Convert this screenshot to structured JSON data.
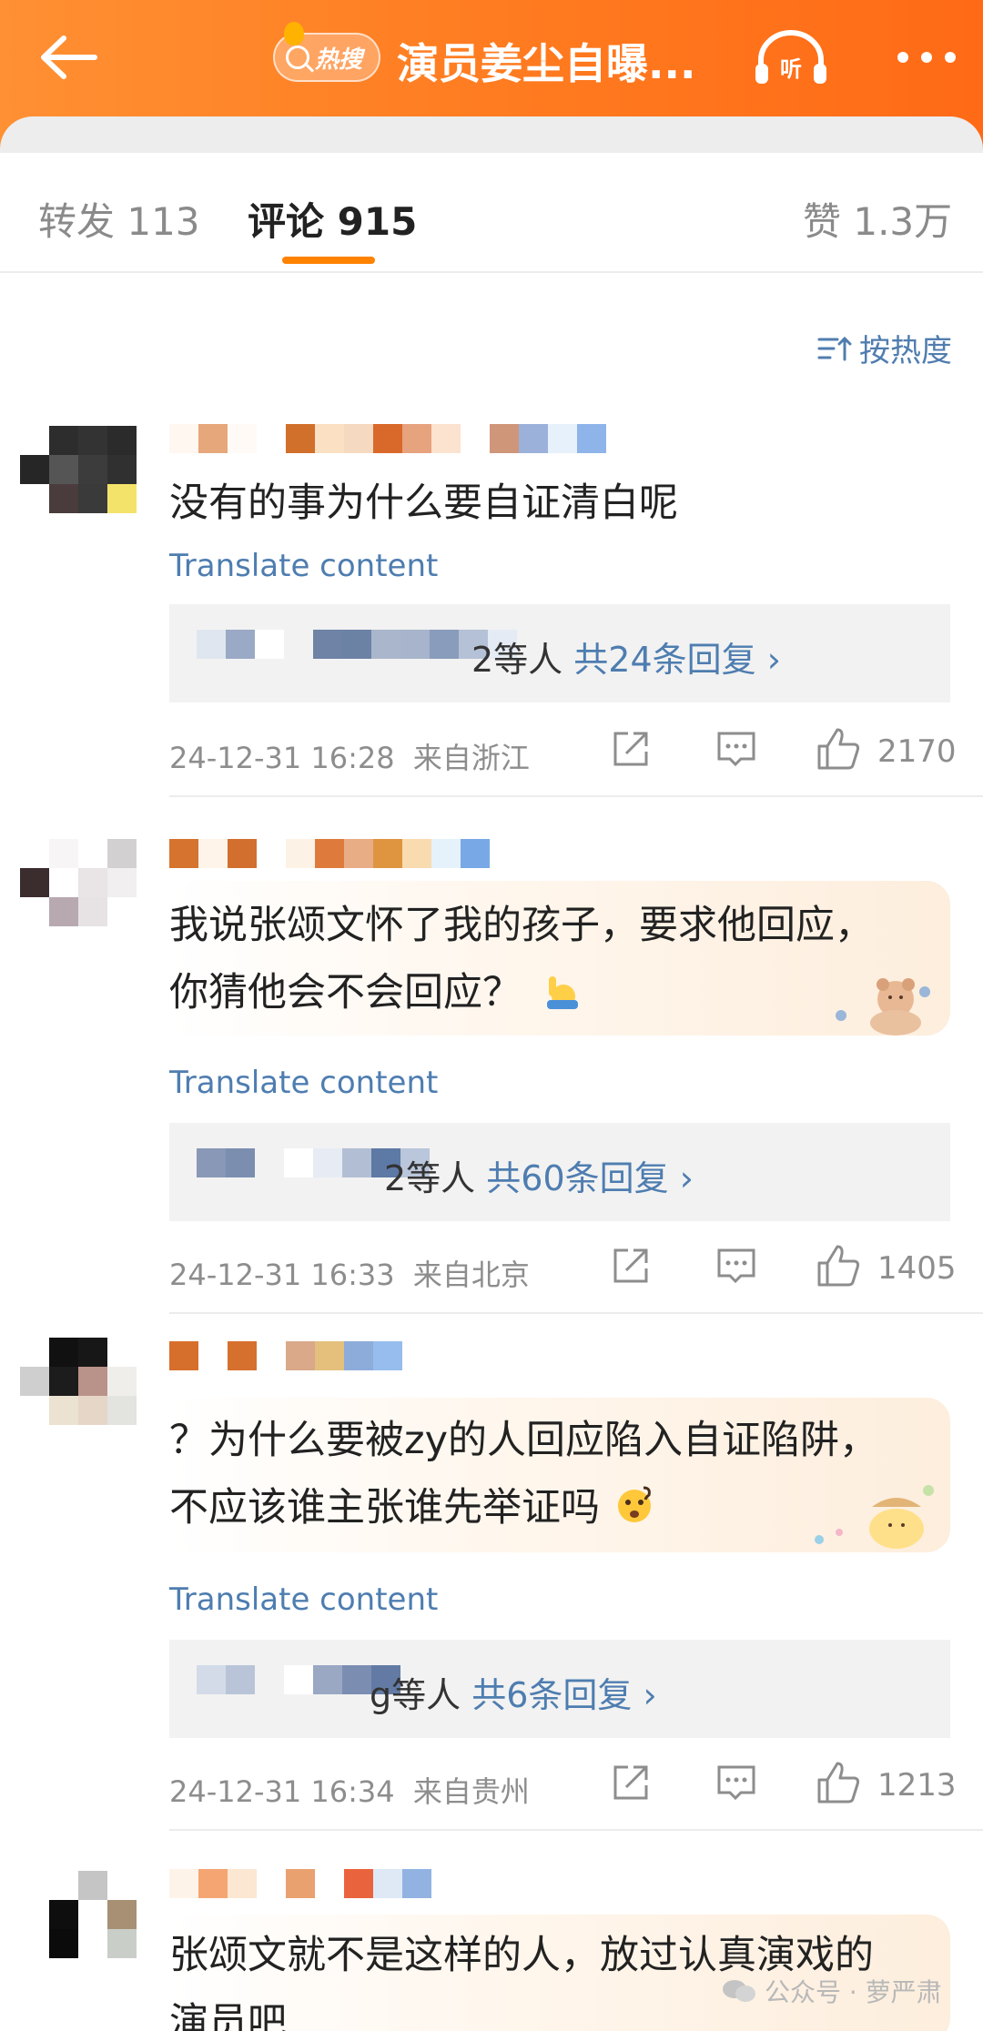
{
  "header": {
    "hot_label": "热搜",
    "title": "演员姜尘自曝...",
    "listen_label": "听",
    "colors": {
      "bar": "#ff7a1f",
      "accent": "#ff8200",
      "link": "#4e7db0"
    }
  },
  "tabs": {
    "repost": "转发 113",
    "comments": "评论 915",
    "likes": "赞 1.3万"
  },
  "sort": {
    "label": "按热度"
  },
  "comments": [
    {
      "text": "没有的事为什么要自证清白呢",
      "translate": "Translate content",
      "reply_prefix": "2等人",
      "reply_count": "共24条回复",
      "time": "24-12-31 16:28",
      "location": "来自浙江",
      "likes": "2170"
    },
    {
      "text_line1": "我说张颂文怀了我的孩子，要求他回应，",
      "text_line2": "你猜他会不会回应？",
      "translate": "Translate content",
      "reply_prefix": "2等人",
      "reply_count": "共60条回复",
      "time": "24-12-31 16:33",
      "location": "来自北京",
      "likes": "1405"
    },
    {
      "text_line1": "？为什么要被zy的人回应陷入自证陷阱，",
      "text_line2": "不应该谁主张谁先举证吗",
      "translate": "Translate content",
      "reply_prefix": "g等人",
      "reply_count": "共6条回复",
      "time": "24-12-31 16:34",
      "location": "来自贵州",
      "likes": "1213"
    },
    {
      "text_line1": "张颂文就不是这样的人，放过认真演戏的",
      "text_line2": "演员吧"
    }
  ],
  "watermark": {
    "label": "公众号 · 萝严肃"
  },
  "icons": [
    "back-arrow-icon",
    "search-icon",
    "headphones-icon",
    "more-dots-icon",
    "sort-icon",
    "share-icon",
    "comment-icon",
    "like-icon",
    "wechat-icon"
  ]
}
